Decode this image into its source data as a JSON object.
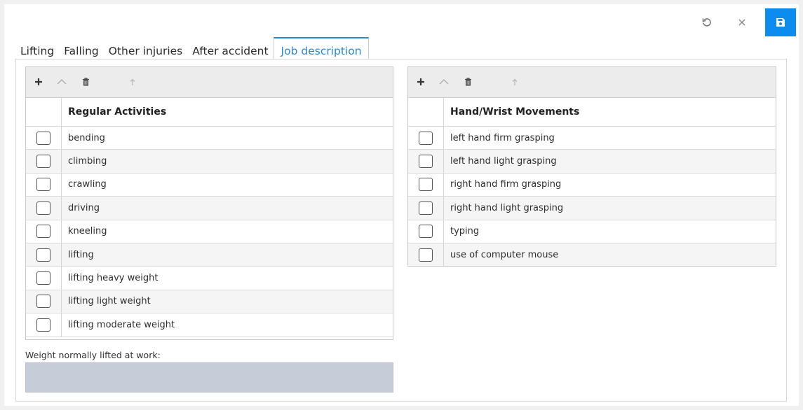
{
  "toolbar": {
    "undo_icon": "undo-icon",
    "close_icon": "close-icon",
    "save_icon": "save-icon",
    "save_color": "#0d8cf0"
  },
  "tabs": [
    {
      "label": "Lifting",
      "active": false
    },
    {
      "label": "Falling",
      "active": false
    },
    {
      "label": "Other injuries",
      "active": false
    },
    {
      "label": "After accident",
      "active": false
    },
    {
      "label": "Job description",
      "active": true
    }
  ],
  "accent_color": "#2a88d8",
  "regular_activities": {
    "header": "Regular Activities",
    "rows": [
      "bending",
      "climbing",
      "crawling",
      "driving",
      "kneeling",
      "lifting",
      "lifting heavy weight",
      "lifting light weight",
      "lifting moderate weight"
    ]
  },
  "hand_wrist": {
    "header": "Hand/Wrist Movements",
    "rows": [
      "left hand firm grasping",
      "left hand light grasping",
      "right hand firm grasping",
      "right hand light grasping",
      "typing",
      "use of computer mouse"
    ]
  },
  "weight": {
    "label": "Weight normally lifted at work:",
    "value": ""
  }
}
